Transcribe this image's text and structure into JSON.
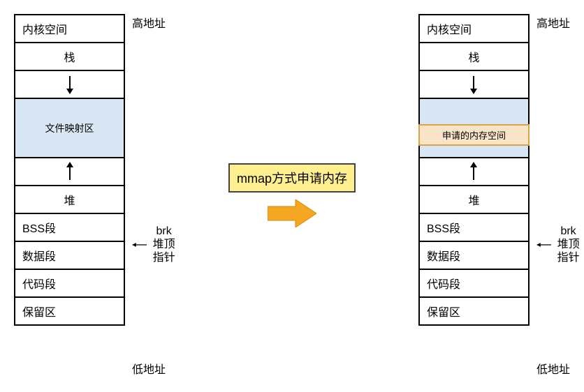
{
  "labels": {
    "high_addr": "高地址",
    "low_addr": "低地址",
    "brk_line1": "brk",
    "brk_line2": "堆顶指针"
  },
  "segments": {
    "kernel": "内核空间",
    "stack": "栈",
    "mapping": "文件映射区",
    "requested": "申请的内存空间",
    "heap": "堆",
    "bss": "BSS段",
    "data": "数据段",
    "text": "代码段",
    "reserved": "保留区"
  },
  "center": {
    "mmap_label": "mmap方式申请内存"
  }
}
